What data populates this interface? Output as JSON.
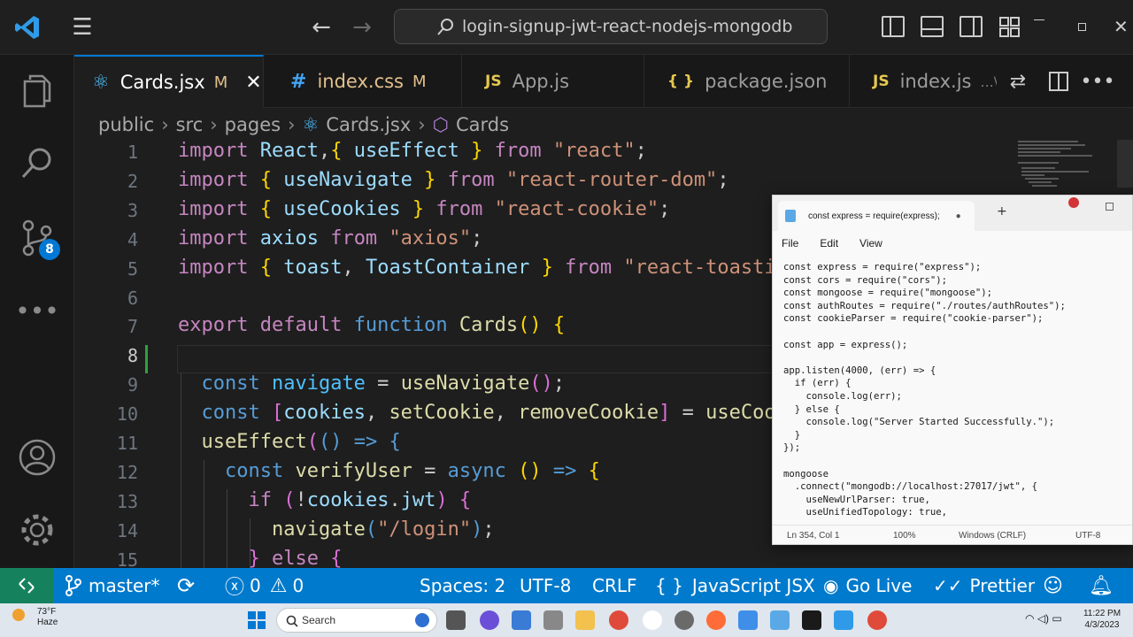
{
  "window": {
    "search_text": "login-signup-jwt-react-nodejs-mongodb"
  },
  "activity": {
    "scm_badge": "8"
  },
  "tabs": [
    {
      "icon": "⚛",
      "label": "Cards.jsx",
      "modified": "M",
      "active": true
    },
    {
      "icon": "#",
      "label": "index.css",
      "modified": "M"
    },
    {
      "icon": "JS",
      "label": "App.js",
      "modified": ""
    },
    {
      "icon": "{ }",
      "label": "package.json",
      "modified": ""
    },
    {
      "icon": "JS",
      "label": "index.js",
      "modified": "...\\"
    }
  ],
  "breadcrumb": [
    "public",
    "src",
    "pages",
    "Cards.jsx",
    "Cards"
  ],
  "editor": {
    "line_numbers": [
      "1",
      "2",
      "3",
      "4",
      "5",
      "6",
      "7",
      "8",
      "9",
      "10",
      "11",
      "12",
      "13",
      "14",
      "15"
    ],
    "lines": [
      [
        [
          "kw",
          "import "
        ],
        [
          "vr",
          "React"
        ],
        [
          "",
          ","
        ],
        [
          "br1",
          "{"
        ],
        [
          "vr",
          " useEffect "
        ],
        [
          "br1",
          "}"
        ],
        [
          "kw",
          " from "
        ],
        [
          "st",
          "\"react\""
        ],
        [
          "",
          ";"
        ]
      ],
      [
        [
          "kw",
          "import "
        ],
        [
          "br1",
          "{"
        ],
        [
          "vr",
          " useNavigate "
        ],
        [
          "br1",
          "}"
        ],
        [
          "kw",
          " from "
        ],
        [
          "st",
          "\"react-router-dom\""
        ],
        [
          "",
          ";"
        ]
      ],
      [
        [
          "kw",
          "import "
        ],
        [
          "br1",
          "{"
        ],
        [
          "vr",
          " useCookies "
        ],
        [
          "br1",
          "}"
        ],
        [
          "kw",
          " from "
        ],
        [
          "st",
          "\"react-cookie\""
        ],
        [
          "",
          ";"
        ]
      ],
      [
        [
          "kw",
          "import "
        ],
        [
          "vr",
          "axios"
        ],
        [
          "kw",
          " from "
        ],
        [
          "st",
          "\"axios\""
        ],
        [
          "",
          ";"
        ]
      ],
      [
        [
          "kw",
          "import "
        ],
        [
          "br1",
          "{"
        ],
        [
          "vr",
          " toast"
        ],
        [
          "",
          ", "
        ],
        [
          "vr",
          "ToastContainer "
        ],
        [
          "br1",
          "}"
        ],
        [
          "kw",
          " from "
        ],
        [
          "st",
          "\"react-toasti"
        ]
      ],
      [],
      [
        [
          "kw",
          "export default "
        ],
        [
          "bl",
          "function "
        ],
        [
          "fn",
          "Cards"
        ],
        [
          "br1",
          "()"
        ],
        [
          "",
          ""
        ],
        [
          "br1",
          " {"
        ]
      ],
      [],
      [
        [
          "bl",
          "  const "
        ],
        [
          "cl",
          "navigate"
        ],
        [
          "",
          " = "
        ],
        [
          "fn",
          "useNavigate"
        ],
        [
          "br2",
          "()"
        ],
        [
          "",
          ";"
        ]
      ],
      [
        [
          "bl",
          "  const "
        ],
        [
          "br2",
          "["
        ],
        [
          "vr",
          "cookies"
        ],
        [
          "",
          ", "
        ],
        [
          "fn",
          "setCookie"
        ],
        [
          "",
          ", "
        ],
        [
          "fn",
          "removeCookie"
        ],
        [
          "br2",
          "]"
        ],
        [
          "",
          " = "
        ],
        [
          "fn",
          "useCoo"
        ]
      ],
      [
        [
          "fn",
          "  useEffect"
        ],
        [
          "br2",
          "("
        ],
        [
          "bl",
          "()"
        ],
        [
          "bl",
          " => "
        ],
        [
          "bl",
          "{"
        ]
      ],
      [
        [
          "bl",
          "    const "
        ],
        [
          "fn",
          "verifyUser"
        ],
        [
          "",
          " = "
        ],
        [
          "bl",
          "async "
        ],
        [
          "br1",
          "()"
        ],
        [
          "bl",
          " => "
        ],
        [
          "br1",
          "{"
        ]
      ],
      [
        [
          "kw",
          "      if "
        ],
        [
          "br2",
          "("
        ],
        [
          "",
          "!"
        ],
        [
          "vr",
          "cookies"
        ],
        [
          "",
          "."
        ],
        [
          "vr",
          "jwt"
        ],
        [
          "br2",
          ")"
        ],
        [
          "br2",
          " {"
        ]
      ],
      [
        [
          "fn",
          "        navigate"
        ],
        [
          "bl",
          "("
        ],
        [
          "st",
          "\"/login\""
        ],
        [
          "bl",
          ")"
        ],
        [
          "",
          ";"
        ]
      ],
      [
        [
          "br2",
          "      }"
        ],
        [
          "kw",
          " else "
        ],
        [
          "br2",
          "{"
        ]
      ]
    ]
  },
  "notepad": {
    "tab_title": "const express = require(express);",
    "menu": [
      "File",
      "Edit",
      "View"
    ],
    "text": "const express = require(\"express\");\nconst cors = require(\"cors\");\nconst mongoose = require(\"mongoose\");\nconst authRoutes = require(\"./routes/authRoutes\");\nconst cookieParser = require(\"cookie-parser\");\n\nconst app = express();\n\napp.listen(4000, (err) => {\n  if (err) {\n    console.log(err);\n  } else {\n    console.log(\"Server Started Successfully.\");\n  }\n});\n\nmongoose\n  .connect(\"mongodb://localhost:27017/jwt\", {\n    useNewUrlParser: true,\n    useUnifiedTopology: true,",
    "status": {
      "position": "Ln 354, Col 1",
      "zoom": "100%",
      "eol": "Windows (CRLF)",
      "encoding": "UTF-8"
    }
  },
  "statusbar": {
    "branch": "master*",
    "errors": "0",
    "warnings": "0",
    "spaces": "Spaces: 2",
    "encoding": "UTF-8",
    "eol": "CRLF",
    "language": "JavaScript JSX",
    "golive": "Go Live",
    "prettier": "Prettier"
  },
  "taskbar": {
    "temp": "73°F",
    "weather": "Haze",
    "search": "Search",
    "time": "11:22 PM",
    "date": "4/3/2023"
  },
  "colors": {
    "accent": "#007acc",
    "remote": "#16825d",
    "keyword": "#c586c0",
    "string": "#ce9178"
  }
}
